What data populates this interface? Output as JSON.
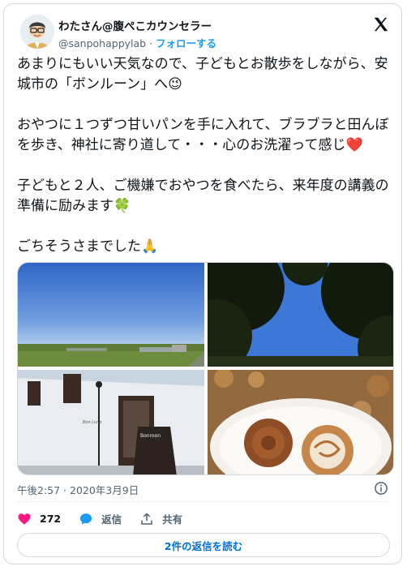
{
  "author": {
    "display_name": "わたさん@腹ぺこカウンセラー",
    "handle": "@sanpohappylab",
    "separator": "·",
    "follow_label": "フォローする"
  },
  "tweet": {
    "paragraphs": [
      "あまりにもいい天気なので、子どもとお散歩をしながら、安城市の「ボンルーン」へ😉",
      "おやつに１つずつ甘いパンを手に入れて、ブラブラと田んぼを歩き、神社に寄り道して・・・心のお洗濯って感じ❤️",
      "子どもと２人、ご機嫌でおやつを食べたら、来年度の講義の準備に励みます🍀",
      "ごちそうさまでした🙏"
    ]
  },
  "media": {
    "sign_text": "Bonroon",
    "facade_text": "Bon Lune"
  },
  "meta": {
    "timestamp": "午後2:57 · 2020年3月9日"
  },
  "actions": {
    "likes": "272",
    "reply_label": "返信",
    "share_label": "共有"
  },
  "read_replies": "2件の返信を読む"
}
